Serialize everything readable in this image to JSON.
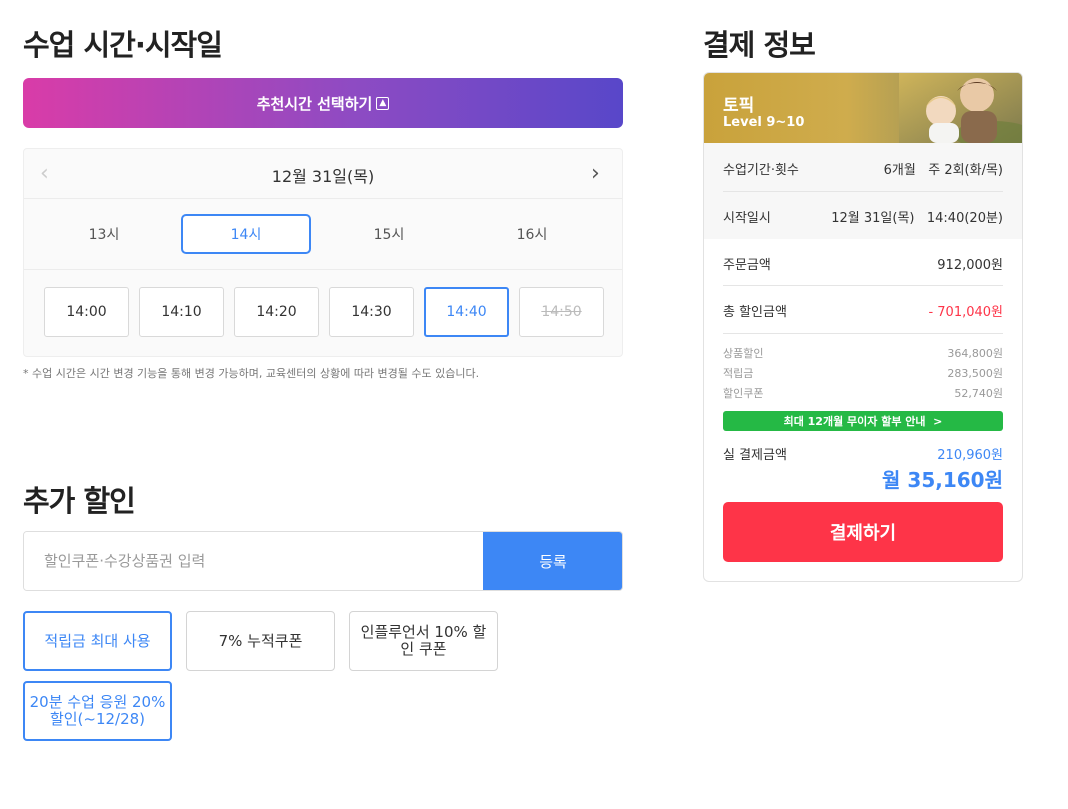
{
  "schedule": {
    "title": "수업 시간·시작일",
    "recommend_label": "추천시간 선택하기",
    "recommend_icon": "chevron-up-box-icon",
    "date": "12월 31일(목)",
    "hours": [
      "13시",
      "14시",
      "15시",
      "16시"
    ],
    "selected_hour": "14시",
    "minutes": [
      "14:00",
      "14:10",
      "14:20",
      "14:30",
      "14:40",
      "14:50"
    ],
    "selected_minute": "14:40",
    "disabled_minute": "14:50",
    "note": "* 수업 시간은 시간 변경 기능을 통해 변경 가능하며, 교육센터의 상황에 따라 변경될 수도 있습니다."
  },
  "discount": {
    "title": "추가 할인",
    "input_placeholder": "할인쿠폰·수강상품권 입력",
    "register_label": "등록",
    "chips": [
      {
        "label": "적립금 최대 사용",
        "selected": true
      },
      {
        "label": "7% 누적쿠폰",
        "selected": false
      },
      {
        "label": "인플루언서 10% 할인 쿠폰",
        "selected": false
      },
      {
        "label": "20분 수업 응원 20% 할인(~12/28)",
        "selected": true
      }
    ]
  },
  "payment": {
    "title": "결제 정보",
    "product_name": "토픽",
    "product_level": "Level 9~10",
    "period_label": "수업기간·횟수",
    "period_value": "6개월   주 2회(화/목)",
    "start_label": "시작일시",
    "start_value": "12월 31일(목)   14:40(20분)",
    "order_label": "주문금액",
    "order_value": "912,000원",
    "discount_label": "총 할인금액",
    "discount_value": "- 701,040원",
    "breakdown": [
      {
        "label": "상품할인",
        "value": "364,800원"
      },
      {
        "label": "적립금",
        "value": "283,500원"
      },
      {
        "label": "할인쿠폰",
        "value": "52,740원"
      }
    ],
    "installment_label": "최대 12개월 무이자 할부 안내  >",
    "final_label": "실 결제금액",
    "final_value": "210,960원",
    "monthly_value": "월 35,160원",
    "pay_button": "결제하기"
  },
  "colors": {
    "accent": "#3d87f5",
    "discount_red": "#fe3448",
    "installment_green": "#25b945",
    "gradient_start": "#d93ca8",
    "gradient_end": "#5847c9"
  }
}
